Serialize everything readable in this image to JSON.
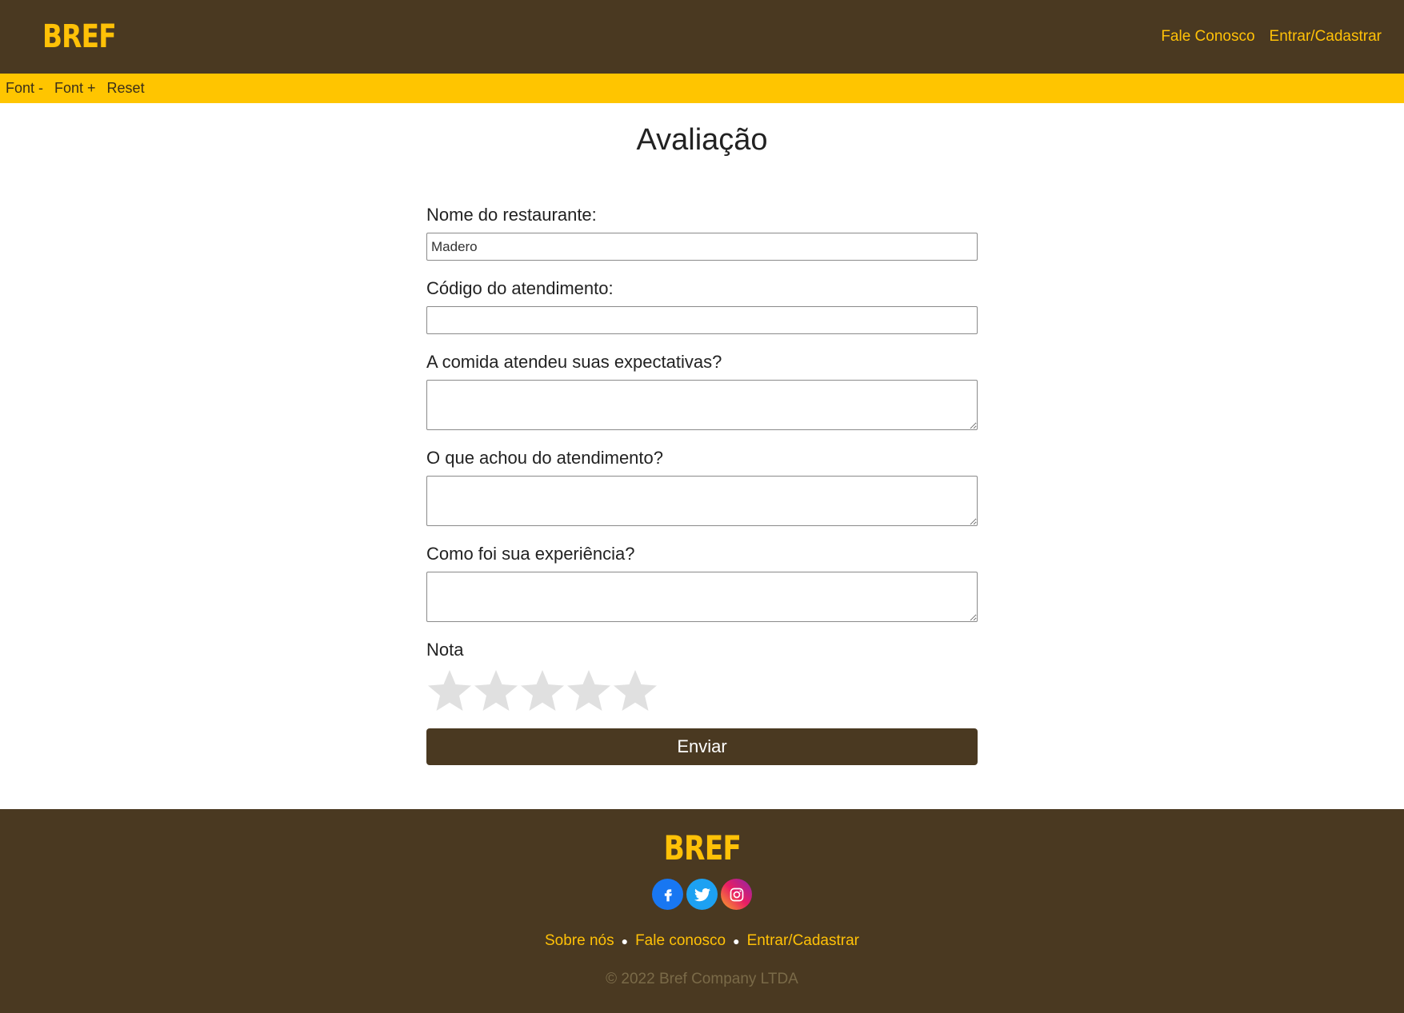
{
  "header": {
    "logo": "BREF",
    "nav": [
      "Fale Conosco",
      "Entrar/Cadastrar"
    ]
  },
  "font_bar": {
    "decrease": "Font -",
    "increase": "Font +",
    "reset": "Reset"
  },
  "form": {
    "title": "Avaliação",
    "restaurant_label": "Nome do restaurante:",
    "restaurant_value": "Madero",
    "code_label": "Código do atendimento:",
    "code_value": "",
    "food_label": "A comida atendeu suas expectativas?",
    "service_label": "O que achou do atendimento?",
    "experience_label": "Como foi sua experiência?",
    "rating_label": "Nota",
    "rating_value": 0,
    "rating_max": 5,
    "submit_label": "Enviar"
  },
  "footer": {
    "logo": "BREF",
    "social": [
      "facebook-icon",
      "twitter-icon",
      "instagram-icon"
    ],
    "links": [
      "Sobre nós",
      "Fale conosco",
      "Entrar/Cadastrar"
    ],
    "copyright": "© 2022 Bref Company LTDA"
  },
  "colors": {
    "brand_dark": "#4a3921",
    "accent_yellow": "#ffc107",
    "star_empty": "#e0e0e0"
  }
}
